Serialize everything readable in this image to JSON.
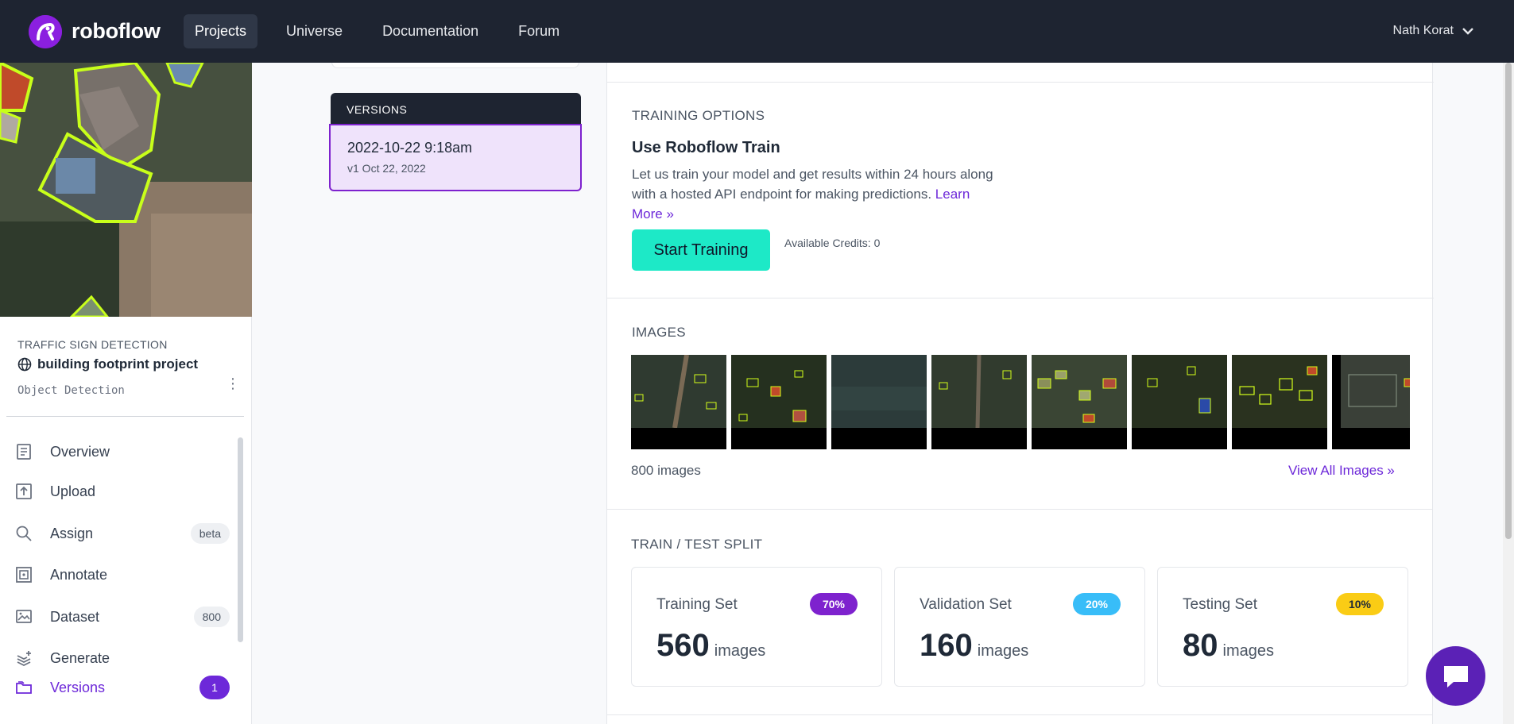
{
  "brand": {
    "name": "roboflow"
  },
  "nav": {
    "links": [
      "Projects",
      "Universe",
      "Documentation",
      "Forum"
    ],
    "user_name": "Nath Korat"
  },
  "project": {
    "kicker": "TRAFFIC SIGN DETECTION",
    "name": "building footprint project",
    "type": "Object Detection"
  },
  "sidebar": {
    "items": [
      {
        "label": "Overview",
        "icon": "overview-icon"
      },
      {
        "label": "Upload",
        "icon": "upload-icon"
      },
      {
        "label": "Assign",
        "icon": "search-icon",
        "badge": "beta"
      },
      {
        "label": "Annotate",
        "icon": "annotate-icon"
      },
      {
        "label": "Dataset",
        "icon": "dataset-icon",
        "badge": "800"
      },
      {
        "label": "Generate",
        "icon": "generate-icon"
      },
      {
        "label": "Versions",
        "icon": "folder-icon",
        "count": "1",
        "active": true
      }
    ]
  },
  "versions": {
    "header": "VERSIONS",
    "selected": {
      "title": "2022-10-22 9:18am",
      "subtitle": "v1 Oct 22, 2022"
    }
  },
  "training": {
    "section_title": "TRAINING OPTIONS",
    "heading": "Use Roboflow Train",
    "description": "Let us train your model and get results within 24 hours along with a hosted API endpoint for making predictions.",
    "learn_more": "Learn More »",
    "button": "Start Training",
    "credits": "Available Credits: 0"
  },
  "images": {
    "section_title": "IMAGES",
    "count_text": "800 images",
    "view_all": "View All Images »"
  },
  "split": {
    "section_title": "TRAIN / TEST SPLIT",
    "cards": [
      {
        "label": "Training Set",
        "percent": "70%",
        "count": "560",
        "unit": "images",
        "badge_color": "#7e22ce",
        "badge_text_color": "#ffffff"
      },
      {
        "label": "Validation Set",
        "percent": "20%",
        "count": "160",
        "unit": "images",
        "badge_color": "#38bdf8",
        "badge_text_color": "#ffffff"
      },
      {
        "label": "Testing Set",
        "percent": "10%",
        "count": "80",
        "unit": "images",
        "badge_color": "#facc15",
        "badge_text_color": "#1f2937"
      }
    ]
  },
  "colors": {
    "accent": "#6d28d9",
    "nav_bg": "#1e2431",
    "train_button": "#1de9c7"
  }
}
